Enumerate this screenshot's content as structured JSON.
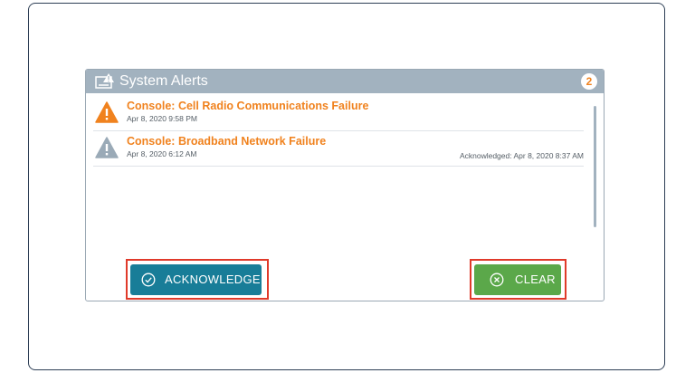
{
  "panel": {
    "title": "System Alerts",
    "count": "2"
  },
  "alerts": [
    {
      "title": "Console: Cell Radio Communications Failure",
      "time": "Apr 8, 2020 9:58 PM",
      "acknowledged": "",
      "icon": "warning-triangle-icon",
      "icon_color": "#f0821e"
    },
    {
      "title": "Console: Broadband Network Failure",
      "time": "Apr 8, 2020 6:12 AM",
      "acknowledged": "Acknowledged: Apr 8, 2020 8:37 AM",
      "icon": "warning-triangle-icon",
      "icon_color": "#9aaab7"
    }
  ],
  "actions": {
    "acknowledge_label": "ACKNOWLEDGE",
    "clear_label": "CLEAR"
  },
  "colors": {
    "alert_title": "#f0821e",
    "header": "#a2b2bf",
    "acknowledge_button": "#187d98",
    "clear_button": "#5ba84a",
    "highlight": "#e03a2a"
  }
}
